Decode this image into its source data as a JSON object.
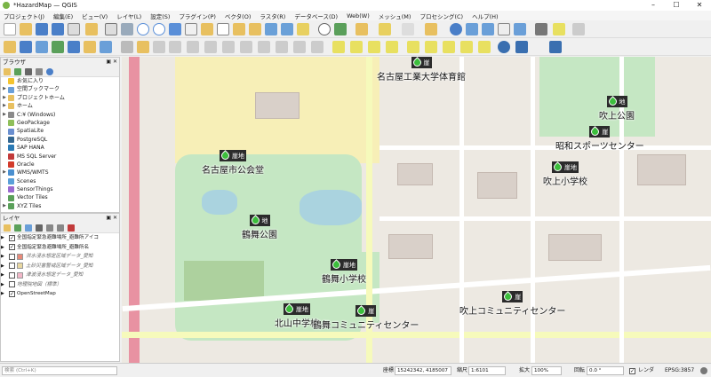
{
  "window": {
    "title": "*HazardMap — QGIS",
    "min": "–",
    "max": "☐",
    "close": "✕"
  },
  "menu": [
    "プロジェクト(J)",
    "編集(E)",
    "ビュー(V)",
    "レイヤ(L)",
    "設定(S)",
    "プラグイン(P)",
    "ベクタ(O)",
    "ラスタ(R)",
    "データベース(D)",
    "Web(W)",
    "メッシュ(M)",
    "プロセシング(C)",
    "ヘルプ(H)"
  ],
  "browser_panel": {
    "title": "ブラウザ",
    "items": [
      {
        "label": "お気に入り",
        "icon": "star-icon",
        "color": "#f4c430",
        "expandable": false
      },
      {
        "label": "空間ブックマーク",
        "icon": "bookmark-icon",
        "color": "#6a9fd8",
        "expandable": true
      },
      {
        "label": "プロジェクトホーム",
        "icon": "folder-icon",
        "color": "#e8c060",
        "expandable": true
      },
      {
        "label": "ホーム",
        "icon": "folder-icon",
        "color": "#e8c060",
        "expandable": true
      },
      {
        "label": "C:¥ (Windows)",
        "icon": "drive-icon",
        "color": "#8a8a8a",
        "expandable": true
      },
      {
        "label": "GeoPackage",
        "icon": "geopackage-icon",
        "color": "#8fbf5a",
        "expandable": false
      },
      {
        "label": "SpatiaLite",
        "icon": "spatialite-icon",
        "color": "#6a8fd0",
        "expandable": false
      },
      {
        "label": "PostgreSQL",
        "icon": "postgresql-icon",
        "color": "#336791",
        "expandable": false
      },
      {
        "label": "SAP HANA",
        "icon": "sap-hana-icon",
        "color": "#2a7ab5",
        "expandable": false
      },
      {
        "label": "MS SQL Server",
        "icon": "mssql-icon",
        "color": "#c23b3b",
        "expandable": false
      },
      {
        "label": "Oracle",
        "icon": "oracle-icon",
        "color": "#d23b2b",
        "expandable": false
      },
      {
        "label": "WMS/WMTS",
        "icon": "wms-icon",
        "color": "#4a8fcf",
        "expandable": true
      },
      {
        "label": "Scenes",
        "icon": "scenes-icon",
        "color": "#5a9fd8",
        "expandable": false
      },
      {
        "label": "SensorThings",
        "icon": "sensorthings-icon",
        "color": "#9a6ad0",
        "expandable": false
      },
      {
        "label": "Vector Tiles",
        "icon": "vector-tiles-icon",
        "color": "#5aa05a",
        "expandable": false
      },
      {
        "label": "XYZ Tiles",
        "icon": "xyz-tiles-icon",
        "color": "#5aa05a",
        "expandable": true
      }
    ]
  },
  "layers_panel": {
    "title": "レイヤ",
    "layers": [
      {
        "label": "全国指定緊急避難場所_避難所アイコ",
        "checked": true,
        "swatch": null,
        "italic": false
      },
      {
        "label": "全国指定緊急避難場所_避難所名",
        "checked": true,
        "swatch": null,
        "italic": false
      },
      {
        "label": "洪水浸水想定区域データ_愛知",
        "checked": false,
        "swatch": "#e88a7a",
        "italic": true
      },
      {
        "label": "土砂災害警戒区域データ_愛知",
        "checked": false,
        "swatch": "#e8d7a0",
        "italic": true
      },
      {
        "label": "津波浸水想定データ_愛知",
        "checked": false,
        "swatch": "#f2b7c8",
        "italic": true
      },
      {
        "label": "地理院地図（標準）",
        "checked": false,
        "swatch": null,
        "italic": true
      },
      {
        "label": "OpenStreetMap",
        "checked": true,
        "swatch": null,
        "italic": false
      }
    ]
  },
  "status": {
    "search_placeholder": "検索 (Ctrl+K)",
    "coord_label": "座標",
    "coord_value": "15242342, 4185007",
    "scale_label": "縮尺",
    "scale_value": "1:6101",
    "magnifier_label": "拡大",
    "magnifier_value": "100%",
    "rotation_label": "回転",
    "rotation_value": "0.0 °",
    "render_label": "レンダ",
    "crs": "EPSG:3857"
  },
  "map": {
    "labels": [
      "名古屋工業大学体育館",
      "名古屋市公会堂",
      "鶴舞公園",
      "鶴舞小学校",
      "北山中学校",
      "鶴舞コミュニティセンター",
      "吹上公園",
      "昭和スポーツセンター",
      "吹上小学校",
      "吹上コミュニティセンター"
    ],
    "badges": [
      "崖",
      "崖地",
      "地",
      "崖",
      "崖地",
      "崖",
      "地",
      "崖",
      "崖地",
      "崖"
    ]
  },
  "colors": {
    "accent": "#3cbe3c",
    "badge_bg": "#2b2b2b",
    "park": "#c5e7c3",
    "rail": "#e892a2"
  }
}
